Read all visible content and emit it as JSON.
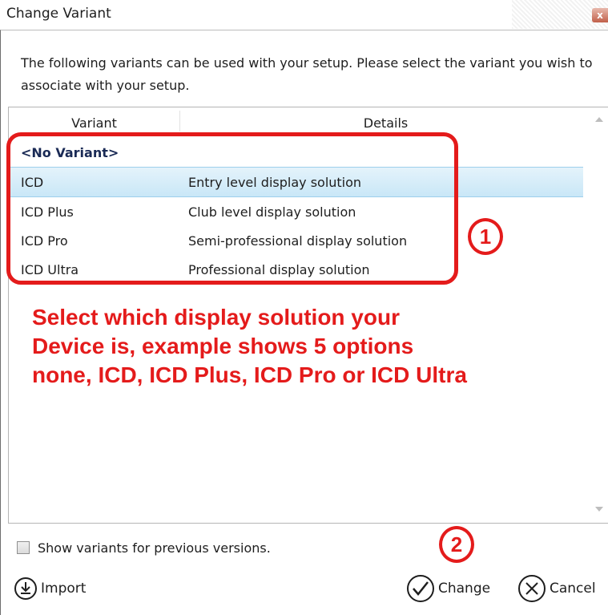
{
  "window": {
    "title": "Change Variant",
    "close_glyph": "x"
  },
  "description": "The following variants can be used with your setup. Please select the variant you wish to associate with your setup.",
  "grid": {
    "columns": [
      "Variant",
      "Details"
    ],
    "rows": [
      {
        "variant": "<No Variant>",
        "details": ""
      },
      {
        "variant": "ICD",
        "details": "Entry level display solution",
        "selected": true
      },
      {
        "variant": "ICD Plus",
        "details": "Club level display solution"
      },
      {
        "variant": "ICD Pro",
        "details": "Semi-professional display solution"
      },
      {
        "variant": "ICD Ultra",
        "details": "Professional display solution"
      }
    ]
  },
  "annotations": {
    "marker1": "1",
    "marker2": "2",
    "text_lines": [
      "Select which display solution your",
      "Device is, example shows 5 options",
      "none, ICD, ICD Plus, ICD Pro or ICD Ultra"
    ],
    "color": "#e41b1b"
  },
  "options": {
    "show_previous_label": "Show variants for previous versions.",
    "show_previous_checked": false
  },
  "buttons": {
    "import": "Import",
    "change": "Change",
    "cancel": "Cancel"
  },
  "icons": {
    "import": "import-icon",
    "change": "checkmark-icon",
    "cancel": "cancel-x-icon"
  }
}
